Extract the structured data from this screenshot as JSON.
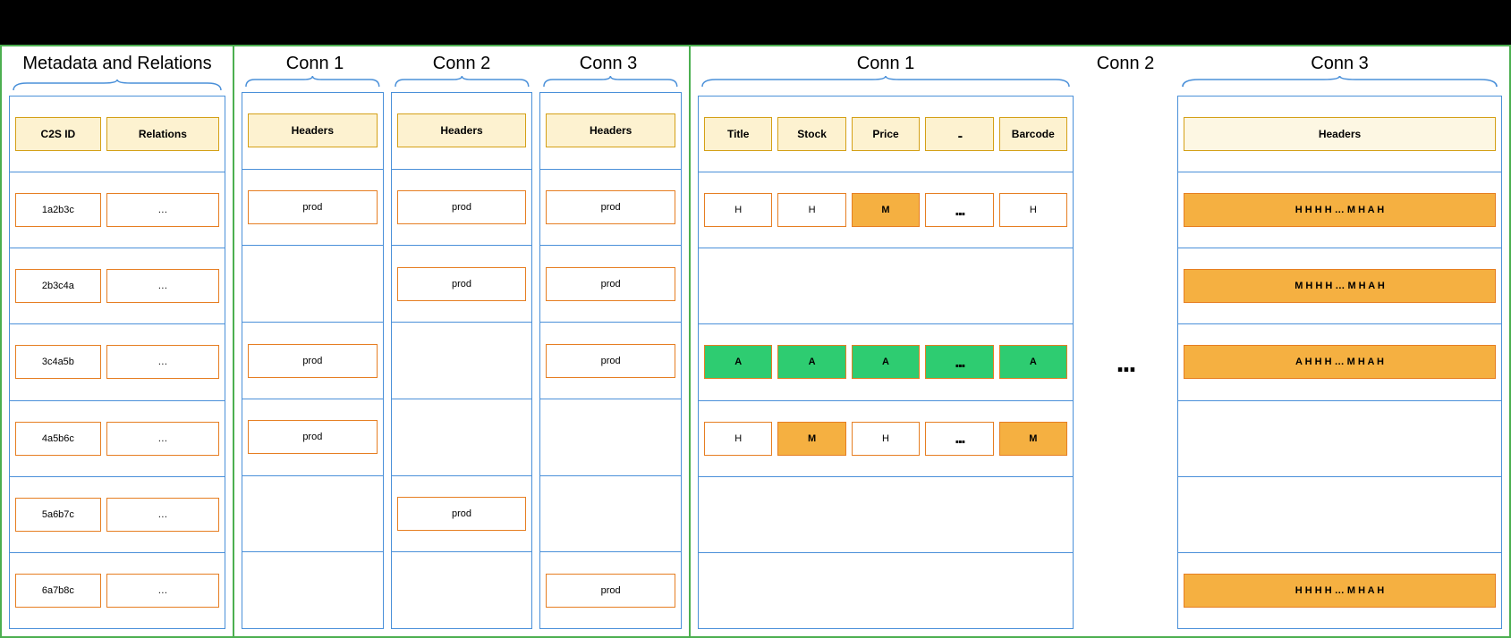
{
  "section1": {
    "title": "Metadata and Relations",
    "headers": [
      "C2S ID",
      "Relations"
    ],
    "rows": [
      [
        "1a2b3c",
        "…"
      ],
      [
        "2b3c4a",
        "…"
      ],
      [
        "3c4a5b",
        "…"
      ],
      [
        "4a5b6c",
        "…"
      ],
      [
        "5a6b7c",
        "…"
      ],
      [
        "6a7b8c",
        "…"
      ]
    ]
  },
  "section2": {
    "titles": [
      "Conn 1",
      "Conn 2",
      "Conn 3"
    ],
    "header_label": "Headers",
    "prod_label": "prod",
    "conn1_rows": [
      "prod",
      "",
      "prod",
      "prod",
      "",
      ""
    ],
    "conn2_rows": [
      "prod",
      "prod",
      "",
      "",
      "prod",
      ""
    ],
    "conn3_rows": [
      "prod",
      "prod",
      "prod",
      "",
      "",
      "prod"
    ]
  },
  "section3": {
    "conn1": {
      "title": "Conn 1",
      "headers": [
        "Title",
        "Stock",
        "Price",
        "...",
        "Barcode"
      ],
      "rows": [
        [
          {
            "v": "H",
            "c": "w"
          },
          {
            "v": "H",
            "c": "w"
          },
          {
            "v": "M",
            "c": "y"
          },
          {
            "v": "...",
            "c": "w"
          },
          {
            "v": "H",
            "c": "w"
          }
        ],
        null,
        [
          {
            "v": "A",
            "c": "g"
          },
          {
            "v": "A",
            "c": "g"
          },
          {
            "v": "A",
            "c": "g"
          },
          {
            "v": "...",
            "c": "g"
          },
          {
            "v": "A",
            "c": "g"
          }
        ],
        [
          {
            "v": "H",
            "c": "w"
          },
          {
            "v": "M",
            "c": "y"
          },
          {
            "v": "H",
            "c": "w"
          },
          {
            "v": "...",
            "c": "w"
          },
          {
            "v": "M",
            "c": "y"
          }
        ],
        null,
        null
      ]
    },
    "conn2": {
      "title": "Conn 2",
      "ellipsis": "..."
    },
    "conn3": {
      "title": "Conn 3",
      "header_label": "Headers",
      "rows": [
        "H H H H … M H A H",
        "M H H H … M H A H",
        "A H H H … M H A H",
        "",
        "",
        "H H H H … M H A H"
      ]
    }
  }
}
